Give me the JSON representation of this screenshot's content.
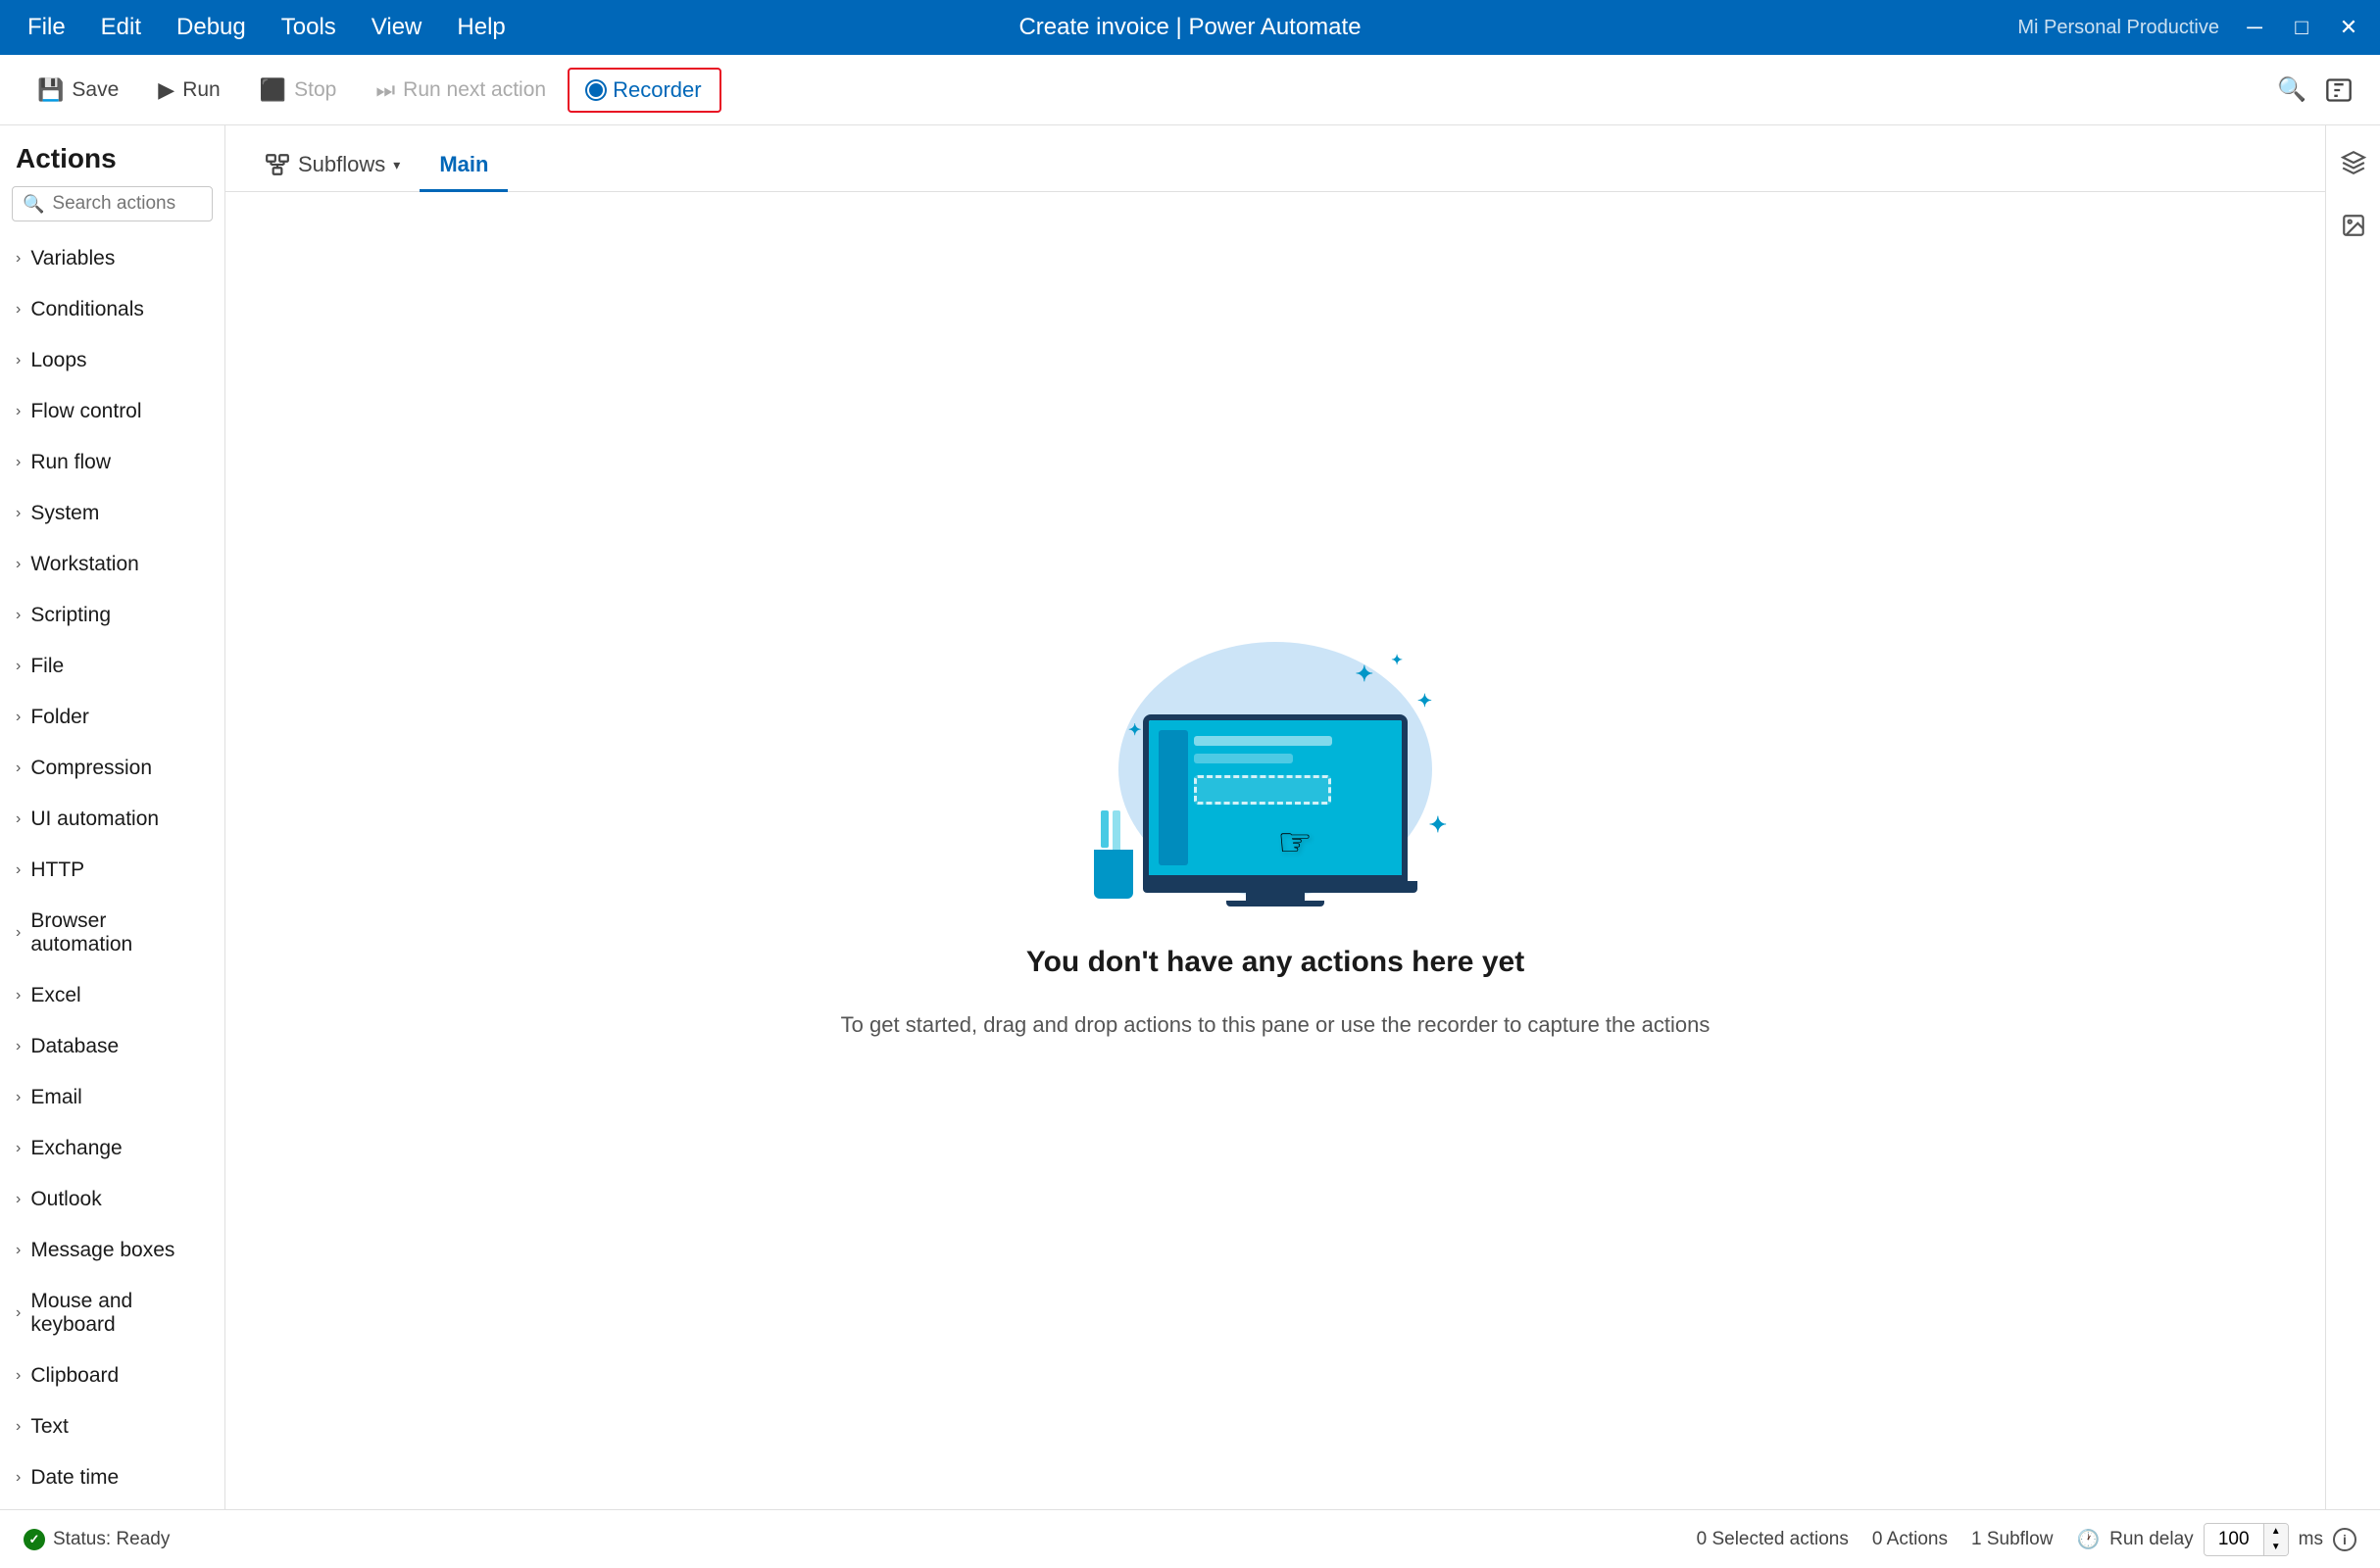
{
  "titlebar": {
    "menu_items": [
      "File",
      "Edit",
      "Debug",
      "Tools",
      "View",
      "Help"
    ],
    "title": "Create invoice | Power Automate",
    "user_label": "Mi Personal Productive",
    "minimize_icon": "─",
    "maximize_icon": "□",
    "close_icon": "✕"
  },
  "toolbar": {
    "save_label": "Save",
    "run_label": "Run",
    "stop_label": "Stop",
    "run_next_label": "Run next action",
    "recorder_label": "Recorder",
    "search_icon": "🔍",
    "variable_icon": "{x}"
  },
  "tabs": {
    "subflows_label": "Subflows",
    "main_label": "Main"
  },
  "sidebar": {
    "header": "Actions",
    "search_placeholder": "Search actions",
    "items": [
      {
        "label": "Variables"
      },
      {
        "label": "Conditionals"
      },
      {
        "label": "Loops"
      },
      {
        "label": "Flow control"
      },
      {
        "label": "Run flow"
      },
      {
        "label": "System"
      },
      {
        "label": "Workstation"
      },
      {
        "label": "Scripting"
      },
      {
        "label": "File"
      },
      {
        "label": "Folder"
      },
      {
        "label": "Compression"
      },
      {
        "label": "UI automation"
      },
      {
        "label": "HTTP"
      },
      {
        "label": "Browser automation"
      },
      {
        "label": "Excel"
      },
      {
        "label": "Database"
      },
      {
        "label": "Email"
      },
      {
        "label": "Exchange"
      },
      {
        "label": "Outlook"
      },
      {
        "label": "Message boxes"
      },
      {
        "label": "Mouse and keyboard"
      },
      {
        "label": "Clipboard"
      },
      {
        "label": "Text"
      },
      {
        "label": "Date time"
      }
    ]
  },
  "canvas": {
    "empty_title": "You don't have any actions here yet",
    "empty_subtitle": "To get started, drag and drop actions to this pane\nor use the recorder to capture the actions"
  },
  "status_bar": {
    "status_label": "Status: Ready",
    "selected_actions": "0 Selected actions",
    "actions_count": "0 Actions",
    "subflow_count": "1 Subflow",
    "run_delay_label": "Run delay",
    "delay_value": "100",
    "delay_unit": "ms",
    "clock_icon": "🕐",
    "info_icon": "i"
  }
}
